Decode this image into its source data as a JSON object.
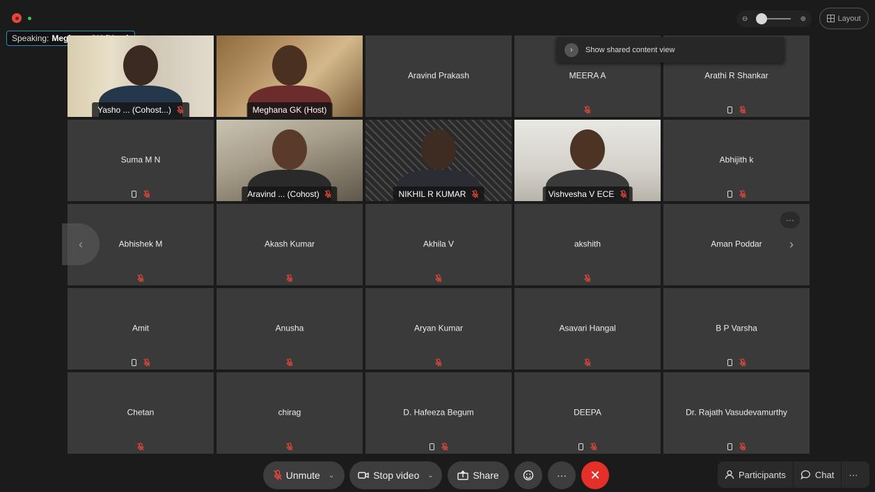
{
  "top_bar": {
    "speaking_label": "Speaking:",
    "speaking_name": "Meghana GK (Host)",
    "zoom_minus": "⊖",
    "zoom_plus": "⊕",
    "layout_label": "Layout"
  },
  "popover": {
    "label": "Show shared content view"
  },
  "tiles": [
    {
      "name": "Yasho ... (Cohost...)",
      "video": "v1",
      "muted": true,
      "phone": false
    },
    {
      "name": "Meghana GK (Host)",
      "video": "v2",
      "muted": false,
      "phone": false,
      "active": true
    },
    {
      "name": "Aravind Prakash",
      "video": null,
      "muted": false,
      "phone": false
    },
    {
      "name": "MEERA A",
      "video": null,
      "muted": true,
      "phone": false
    },
    {
      "name": "Arathi R Shankar",
      "video": null,
      "muted": true,
      "phone": true
    },
    {
      "name": "Suma M N",
      "video": null,
      "muted": true,
      "phone": true
    },
    {
      "name": "Aravind ... (Cohost)",
      "video": "v3",
      "muted": true,
      "phone": false
    },
    {
      "name": "NIKHIL R KUMAR",
      "video": "v4",
      "muted": true,
      "phone": false
    },
    {
      "name": "Vishvesha V ECE",
      "video": "v5",
      "muted": true,
      "phone": false
    },
    {
      "name": "Abhijith k",
      "video": null,
      "muted": true,
      "phone": true
    },
    {
      "name": "Abhishek M",
      "video": null,
      "muted": true,
      "phone": false
    },
    {
      "name": "Akash Kumar",
      "video": null,
      "muted": true,
      "phone": false
    },
    {
      "name": "Akhila V",
      "video": null,
      "muted": true,
      "phone": false
    },
    {
      "name": "akshith",
      "video": null,
      "muted": true,
      "phone": false
    },
    {
      "name": "Aman Poddar",
      "video": null,
      "muted": false,
      "phone": false
    },
    {
      "name": "Amit",
      "video": null,
      "muted": true,
      "phone": true
    },
    {
      "name": "Anusha",
      "video": null,
      "muted": true,
      "phone": false
    },
    {
      "name": "Aryan Kumar",
      "video": null,
      "muted": true,
      "phone": false
    },
    {
      "name": "Asavari Hangal",
      "video": null,
      "muted": true,
      "phone": false
    },
    {
      "name": "B P Varsha",
      "video": null,
      "muted": true,
      "phone": true
    },
    {
      "name": "Chetan",
      "video": null,
      "muted": true,
      "phone": false
    },
    {
      "name": "chirag",
      "video": null,
      "muted": true,
      "phone": false
    },
    {
      "name": "D. Hafeeza Begum",
      "video": null,
      "muted": true,
      "phone": true
    },
    {
      "name": "DEEPA",
      "video": null,
      "muted": true,
      "phone": true
    },
    {
      "name": "Dr. Rajath Vasudevamurthy",
      "video": null,
      "muted": true,
      "phone": true
    }
  ],
  "tile_more": "···",
  "nav": {
    "prev": "‹",
    "next": "›"
  },
  "toolbar": {
    "unmute": "Unmute",
    "stop_video": "Stop video",
    "share": "Share",
    "more": "···",
    "end": "✕",
    "participants": "Participants",
    "chat": "Chat",
    "overflow": "···"
  },
  "colors": {
    "accent": "#34b3e6",
    "muted": "#e5483a",
    "end": "#e5302a"
  }
}
